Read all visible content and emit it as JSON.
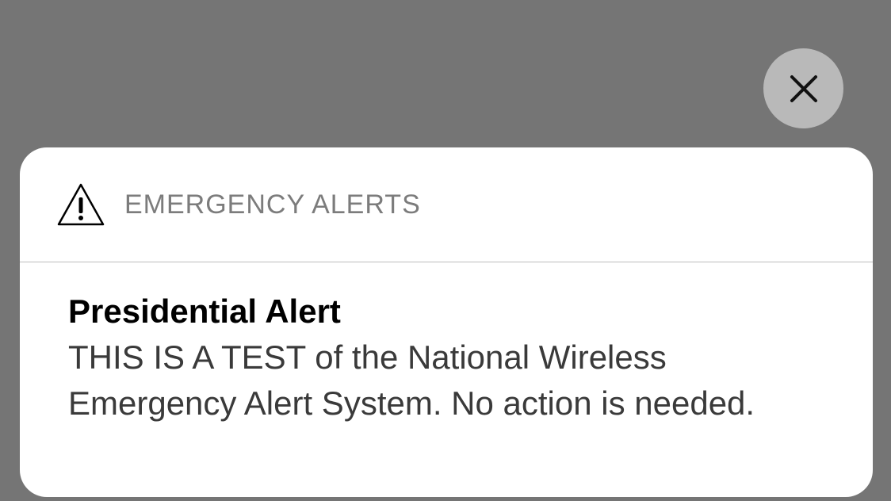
{
  "close_button": {
    "icon": "close-icon",
    "background": "#b9b9b9"
  },
  "alert": {
    "app_icon": "warning-triangle-icon",
    "app_name": "EMERGENCY ALERTS",
    "title": "Presidential Alert",
    "message": "THIS IS A TEST of the National Wireless Emergency Alert System. No action is needed."
  },
  "colors": {
    "overlay": "#757575",
    "card": "#ffffff",
    "header_text": "#7c7c7c",
    "title_text": "#000000",
    "body_text": "#3a3a3a"
  }
}
